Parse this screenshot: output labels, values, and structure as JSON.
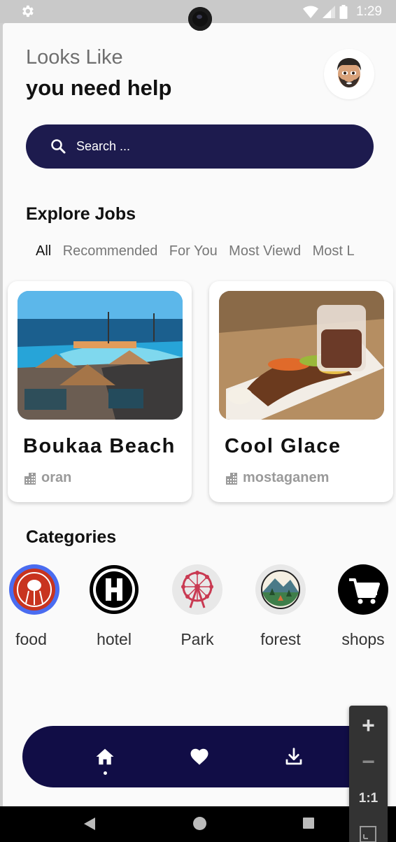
{
  "status_bar": {
    "time": "1:29"
  },
  "header": {
    "greeting_line1": "Looks Like",
    "greeting_line2": "you need help",
    "avatar_icon": "memoji-avatar-icon"
  },
  "search": {
    "placeholder": "Search ..."
  },
  "explore": {
    "title": "Explore Jobs",
    "tabs": [
      "All",
      "Recommended",
      "For You",
      "Most Viewd",
      "Most L"
    ],
    "active_tab": "All"
  },
  "cards": [
    {
      "title": "Boukaa Beach",
      "location": "oran"
    },
    {
      "title": "Cool Glace",
      "location": "mostaganem"
    }
  ],
  "categories": {
    "title": "Categories",
    "items": [
      {
        "label": "food",
        "icon": "food-icon"
      },
      {
        "label": "hotel",
        "icon": "hotel-icon"
      },
      {
        "label": "Park",
        "icon": "ferris-wheel-icon"
      },
      {
        "label": "forest",
        "icon": "forest-icon"
      },
      {
        "label": "shops",
        "icon": "cart-icon"
      }
    ]
  },
  "bottom_nav": {
    "items": [
      "home-icon",
      "heart-icon",
      "download-icon"
    ],
    "active": "home-icon"
  },
  "zoom_control": {
    "plus": "+",
    "minus": "−",
    "ratio": "1:1"
  },
  "colors": {
    "primary": "#1d1b4e",
    "nav": "#110d46",
    "background": "#fafafa"
  }
}
